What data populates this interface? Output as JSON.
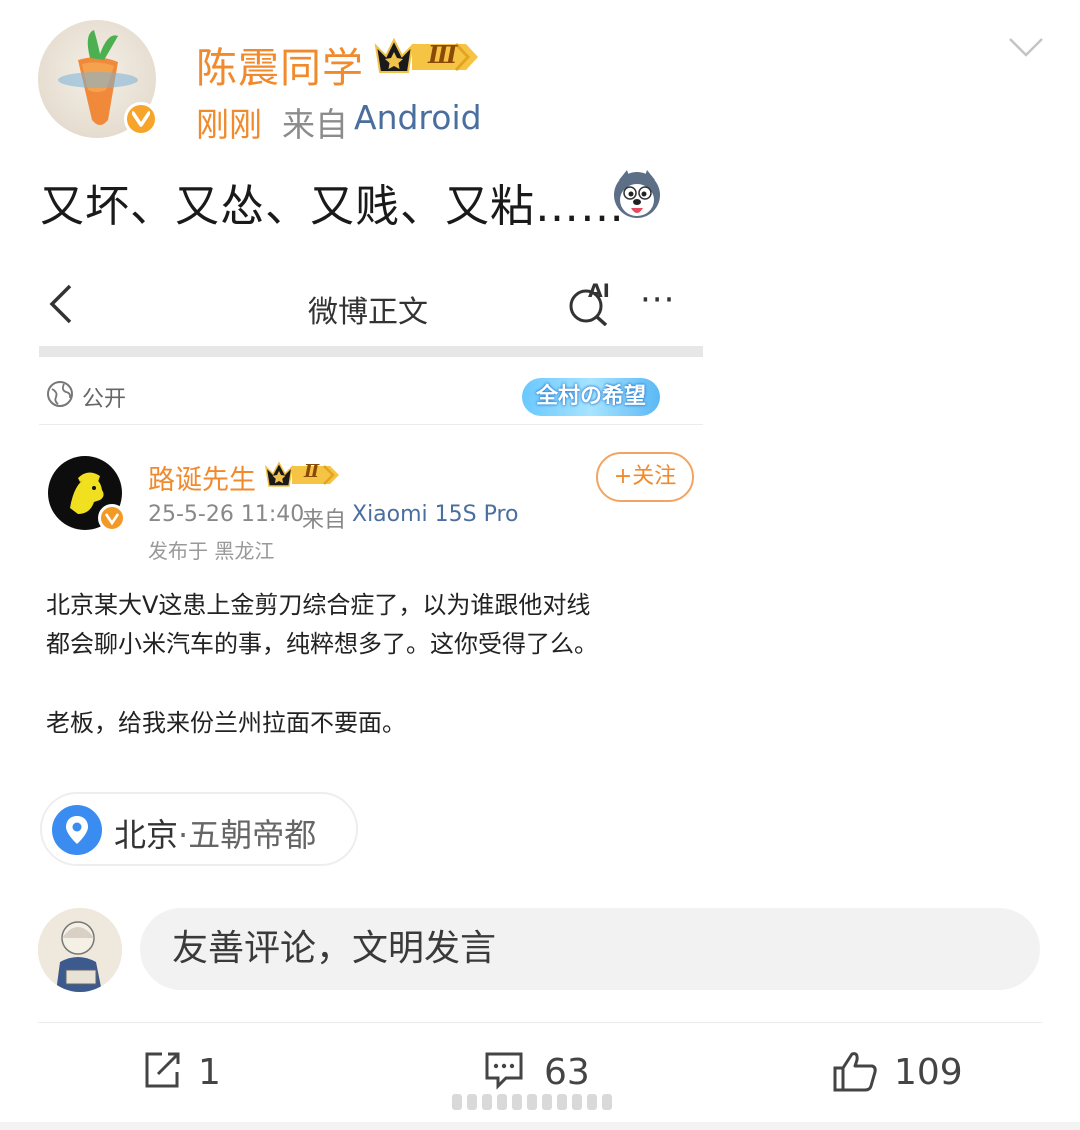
{
  "post": {
    "author": "陈震同学",
    "level_badge": "Ⅲ",
    "time": "刚刚",
    "source_prefix": "来自",
    "device": "Android",
    "text": "又坏、又怂、又贱、又粘……"
  },
  "embedded": {
    "nav_title": "微博正文",
    "ai_label": "AI",
    "more_label": "···",
    "visibility": "公开",
    "sticker_text": "全村の希望",
    "author": "路诞先生",
    "level_badge": "Ⅱ",
    "follow_label": "+关注",
    "time": "25-5-26 11:40",
    "source_prefix": "来自",
    "device": "Xiaomi 15S Pro",
    "location": "发布于 黑龙江",
    "body_line1": "北京某大V这患上金剪刀综合症了，以为谁跟他对线",
    "body_line2": "都会聊小米汽车的事，纯粹想多了。这你受得了么。",
    "body_line3": "老板，给我来份兰州拉面不要面。"
  },
  "location_chip": {
    "city": "北京",
    "separator": "·",
    "name": "五朝帝都"
  },
  "composer": {
    "placeholder": "友善评论，文明发言"
  },
  "actions": {
    "repost_count": "1",
    "comment_count": "63",
    "like_count": "109"
  },
  "colors": {
    "accent_orange": "#f08a2c",
    "link_blue": "#4a6e9e",
    "location_blue": "#3b8cf0"
  }
}
